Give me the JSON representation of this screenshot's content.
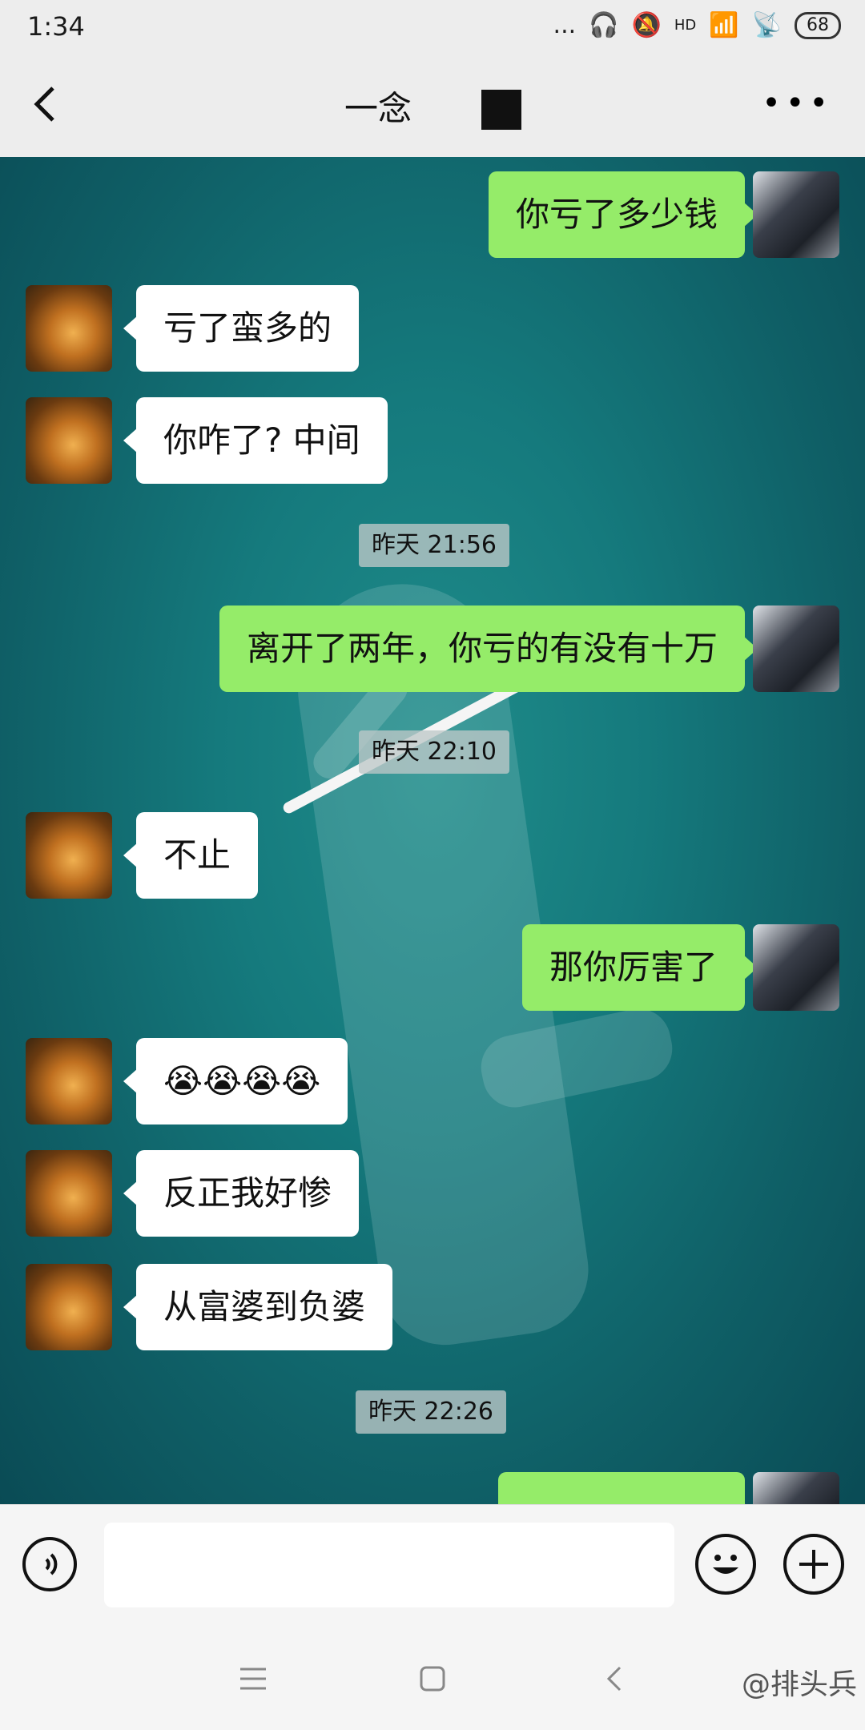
{
  "status": {
    "time": "1:34",
    "dots": "...",
    "hd": "HD",
    "battery": "68"
  },
  "header": {
    "title": "一念"
  },
  "messages": [
    {
      "side": "me",
      "text": "你亏了多少钱"
    },
    {
      "side": "other",
      "text": "亏了蛮多的"
    },
    {
      "side": "other",
      "text": "你咋了? 中间"
    },
    {
      "side": "ts",
      "text": "昨天 21:56"
    },
    {
      "side": "me",
      "text": "离开了两年，你亏的有没有十万"
    },
    {
      "side": "ts",
      "text": "昨天 22:10"
    },
    {
      "side": "other",
      "text": "不止"
    },
    {
      "side": "me",
      "text": "那你厉害了"
    },
    {
      "side": "other",
      "text": "😭😭😭😭"
    },
    {
      "side": "other",
      "text": "反正我好惨"
    },
    {
      "side": "other",
      "text": "从富婆到负婆"
    },
    {
      "side": "ts",
      "text": "昨天 22:26"
    }
  ],
  "input": {
    "placeholder": ""
  },
  "watermark": "@排头兵",
  "colors": {
    "me_bubble": "#95ec69",
    "other_bubble": "#ffffff",
    "bar": "#ededed"
  }
}
